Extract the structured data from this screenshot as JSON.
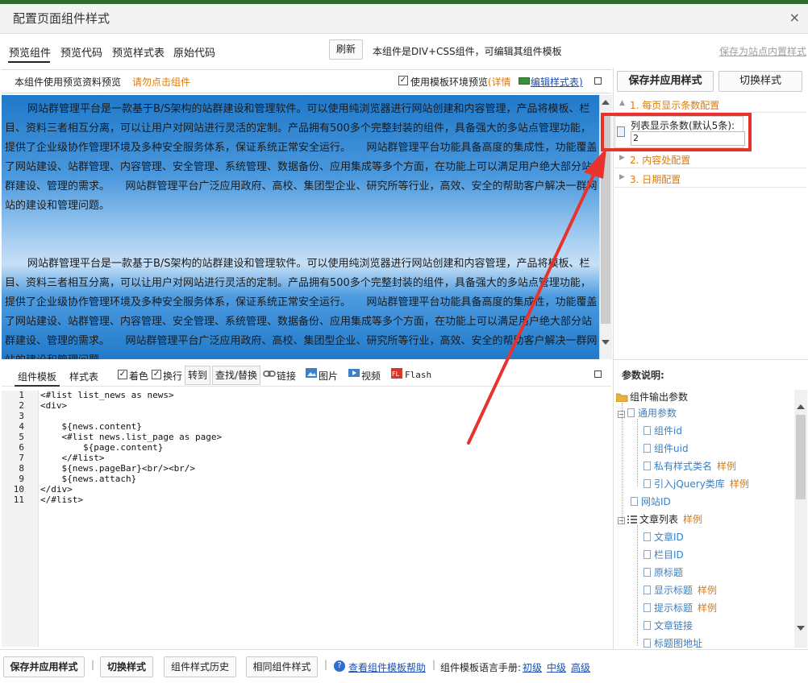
{
  "window": {
    "title": "配置页面组件样式",
    "close_glyph": "×"
  },
  "tabs": [
    {
      "label": "预览组件",
      "active": true
    },
    {
      "label": "预览代码"
    },
    {
      "label": "预览样式表"
    },
    {
      "label": "原始代码"
    }
  ],
  "toolbar": {
    "refresh_label": "刷新",
    "info_text": "本组件是DIV+CSS组件，可编辑其组件模板",
    "save_site_label": "保存为站点内置样式"
  },
  "preview_header": {
    "note": "本组件使用预览资料预览",
    "click_hint": "请勿点击组件",
    "use_env_label": "使用模板环境预览",
    "detail_label": "(详情",
    "edit_css_label": "编辑样式表)"
  },
  "preview": {
    "paragraphs": [
      "网站群管理平台是一款基于B/S架构的站群建设和管理软件。可以使用纯浏览器进行网站创建和内容管理，产品将模板、栏目、资料三者相互分离，可以让用户对网站进行灵活的定制。产品拥有500多个完整封装的组件，具备强大的多站点管理功能，提供了企业级协作管理环境及多种安全服务体系，保证系统正常安全运行。　　网站群管理平台功能具备高度的集成性，功能覆盖了网站建设、站群管理、内容管理、安全管理、系统管理、数据备份、应用集成等多个方面，在功能上可以满足用户绝大部分站群建设、管理的需求。　　网站群管理平台广泛应用政府、高校、集团型企业、研究所等行业，高效、安全的帮助客户解决一群网站的建设和管理问题。",
      "网站群管理平台是一款基于B/S架构的站群建设和管理软件。可以使用纯浏览器进行网站创建和内容管理，产品将模板、栏目、资料三者相互分离，可以让用户对网站进行灵活的定制。产品拥有500多个完整封装的组件，具备强大的多站点管理功能，提供了企业级协作管理环境及多种安全服务体系，保证系统正常安全运行。　　网站群管理平台功能具备高度的集成性，功能覆盖了网站建设、站群管理、内容管理、安全管理、系统管理、数据备份、应用集成等多个方面，在功能上可以满足用户绝大部分站群建设、管理的需求。　　网站群管理平台广泛应用政府、高校、集团型企业、研究所等行业，高效、安全的帮助客户解决一群网站的建设和管理问题。"
    ]
  },
  "editor": {
    "tabs": [
      {
        "label": "组件模板",
        "active": true
      },
      {
        "label": "样式表"
      }
    ],
    "tools": {
      "color": "着色",
      "wrap": "换行",
      "goto": "转到",
      "find": "查找/替换",
      "link": "链接",
      "image": "图片",
      "video": "视频",
      "flash": "Flash"
    },
    "lines": [
      {
        "n": "1",
        "code": "<#list list_news as news>"
      },
      {
        "n": "2",
        "code": "<div>"
      },
      {
        "n": "3",
        "code": ""
      },
      {
        "n": "4",
        "code": "    ${news.content}"
      },
      {
        "n": "5",
        "code": "    <#list news.list_page as page>"
      },
      {
        "n": "6",
        "code": "        ${page.content}"
      },
      {
        "n": "7",
        "code": "    </#list>"
      },
      {
        "n": "8",
        "code": "    ${news.pageBar}<br/><br/>"
      },
      {
        "n": "9",
        "code": "    ${news.attach}"
      },
      {
        "n": "10",
        "code": "</div>"
      },
      {
        "n": "11",
        "code": "</#list>"
      }
    ]
  },
  "right": {
    "save_apply_label": "保存并应用样式",
    "switch_label": "切换样式",
    "sections": [
      {
        "label": "1. 每页显示条数配置",
        "expanded": true
      },
      {
        "label": "2. 内容处配置"
      },
      {
        "label": "3. 日期配置"
      }
    ],
    "param": {
      "label": "列表显示条数(默认5条):",
      "value": "2"
    },
    "param_desc_title": "参数说明:",
    "tree": {
      "root": "组件输出参数",
      "common": "通用参数",
      "common_items": [
        {
          "label": "组件id"
        },
        {
          "label": "组件uid"
        },
        {
          "label": "私有样式类名",
          "example": "样例"
        },
        {
          "label": "引入jQuery类库",
          "example": "样例"
        }
      ],
      "site_id": "网站ID",
      "article_list": "文章列表",
      "article_list_example": "样例",
      "article_items": [
        {
          "label": "文章ID"
        },
        {
          "label": "栏目ID"
        },
        {
          "label": "原标题"
        },
        {
          "label": "显示标题",
          "example": "样例"
        },
        {
          "label": "提示标题",
          "example": "样例"
        },
        {
          "label": "文章链接"
        },
        {
          "label": "标题图地址"
        }
      ]
    }
  },
  "bottom": {
    "save_apply_label": "保存并应用样式",
    "switch_label": "切换样式",
    "history_label": "组件样式历史",
    "same_label": "相同组件样式",
    "help_link": "查看组件模板帮助",
    "manual_label": "组件模板语言手册:",
    "level_basic": "初级",
    "level_mid": "中级",
    "level_adv": "高级",
    "separator": "|"
  },
  "colors": {
    "accent_orange": "#e07a00",
    "link_blue": "#1a4fb8",
    "annotation_red": "#e8322e",
    "preview_blue": "#1f79c9"
  }
}
